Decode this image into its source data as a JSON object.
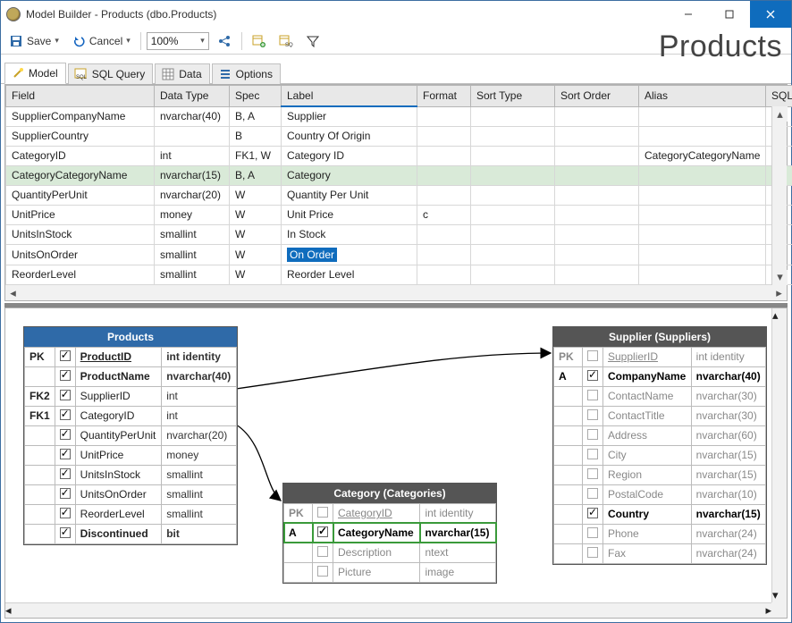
{
  "window": {
    "title": "Model Builder - Products (dbo.Products)"
  },
  "toolbar": {
    "save": "Save",
    "cancel": "Cancel",
    "zoom": "100%",
    "heading": "Products"
  },
  "tabs": {
    "model": "Model",
    "sql": "SQL Query",
    "data": "Data",
    "options": "Options"
  },
  "grid": {
    "headers": {
      "field": "Field",
      "dataType": "Data Type",
      "spec": "Spec",
      "label": "Label",
      "format": "Format",
      "sortType": "Sort Type",
      "sortOrder": "Sort Order",
      "alias": "Alias",
      "sqlfn": "SQL Fn"
    },
    "rows": [
      {
        "field": "SupplierCompanyName",
        "dataType": "nvarchar(40)",
        "spec": "B, A",
        "label": "Supplier",
        "format": "",
        "sortType": "",
        "sortOrder": "",
        "alias": ""
      },
      {
        "field": "SupplierCountry",
        "dataType": "",
        "spec": "B",
        "label": "Country Of Origin",
        "format": "",
        "sortType": "",
        "sortOrder": "",
        "alias": ""
      },
      {
        "field": "CategoryID",
        "dataType": "int",
        "spec": "FK1, W",
        "label": "Category ID",
        "format": "",
        "sortType": "",
        "sortOrder": "",
        "alias": "CategoryCategoryName"
      },
      {
        "field": "CategoryCategoryName",
        "dataType": "nvarchar(15)",
        "spec": "B, A",
        "label": "Category",
        "format": "",
        "sortType": "",
        "sortOrder": "",
        "alias": ""
      },
      {
        "field": "QuantityPerUnit",
        "dataType": "nvarchar(20)",
        "spec": "W",
        "label": "Quantity Per Unit",
        "format": "",
        "sortType": "",
        "sortOrder": "",
        "alias": ""
      },
      {
        "field": "UnitPrice",
        "dataType": "money",
        "spec": "W",
        "label": "Unit Price",
        "format": "c",
        "sortType": "",
        "sortOrder": "",
        "alias": ""
      },
      {
        "field": "UnitsInStock",
        "dataType": "smallint",
        "spec": "W",
        "label": "In Stock",
        "format": "",
        "sortType": "",
        "sortOrder": "",
        "alias": ""
      },
      {
        "field": "UnitsOnOrder",
        "dataType": "smallint",
        "spec": "W",
        "label": "On Order",
        "format": "",
        "sortType": "",
        "sortOrder": "",
        "alias": ""
      },
      {
        "field": "ReorderLevel",
        "dataType": "smallint",
        "spec": "W",
        "label": "Reorder Level",
        "format": "",
        "sortType": "",
        "sortOrder": "",
        "alias": ""
      }
    ]
  },
  "entities": {
    "products": {
      "title": "Products",
      "cols": [
        {
          "key": "PK",
          "chk": true,
          "name": "ProductID",
          "type": "int identity",
          "bold": true,
          "under": true
        },
        {
          "key": "",
          "chk": true,
          "name": "ProductName",
          "type": "nvarchar(40)",
          "bold": true
        },
        {
          "key": "FK2",
          "chk": true,
          "name": "SupplierID",
          "type": "int"
        },
        {
          "key": "FK1",
          "chk": true,
          "name": "CategoryID",
          "type": "int"
        },
        {
          "key": "",
          "chk": true,
          "name": "QuantityPerUnit",
          "type": "nvarchar(20)"
        },
        {
          "key": "",
          "chk": true,
          "name": "UnitPrice",
          "type": "money"
        },
        {
          "key": "",
          "chk": true,
          "name": "UnitsInStock",
          "type": "smallint"
        },
        {
          "key": "",
          "chk": true,
          "name": "UnitsOnOrder",
          "type": "smallint"
        },
        {
          "key": "",
          "chk": true,
          "name": "ReorderLevel",
          "type": "smallint"
        },
        {
          "key": "",
          "chk": true,
          "name": "Discontinued",
          "type": "bit",
          "bold": true
        }
      ]
    },
    "category": {
      "title": "Category (Categories)",
      "cols": [
        {
          "key": "PK",
          "chk": false,
          "name": "CategoryID",
          "type": "int identity",
          "under": true,
          "dim": true
        },
        {
          "key": "A",
          "chk": true,
          "name": "CategoryName",
          "type": "nvarchar(15)",
          "highlight": true
        },
        {
          "key": "",
          "chk": false,
          "name": "Description",
          "type": "ntext",
          "dim": true
        },
        {
          "key": "",
          "chk": false,
          "name": "Picture",
          "type": "image",
          "dim": true
        }
      ]
    },
    "supplier": {
      "title": "Supplier (Suppliers)",
      "cols": [
        {
          "key": "PK",
          "chk": false,
          "name": "SupplierID",
          "type": "int identity",
          "under": true,
          "dim": true
        },
        {
          "key": "A",
          "chk": true,
          "name": "CompanyName",
          "type": "nvarchar(40)",
          "bold": true
        },
        {
          "key": "",
          "chk": false,
          "name": "ContactName",
          "type": "nvarchar(30)",
          "dim": true
        },
        {
          "key": "",
          "chk": false,
          "name": "ContactTitle",
          "type": "nvarchar(30)",
          "dim": true
        },
        {
          "key": "",
          "chk": false,
          "name": "Address",
          "type": "nvarchar(60)",
          "dim": true
        },
        {
          "key": "",
          "chk": false,
          "name": "City",
          "type": "nvarchar(15)",
          "dim": true
        },
        {
          "key": "",
          "chk": false,
          "name": "Region",
          "type": "nvarchar(15)",
          "dim": true
        },
        {
          "key": "",
          "chk": false,
          "name": "PostalCode",
          "type": "nvarchar(10)",
          "dim": true
        },
        {
          "key": "",
          "chk": true,
          "name": "Country",
          "type": "nvarchar(15)",
          "bold": true
        },
        {
          "key": "",
          "chk": false,
          "name": "Phone",
          "type": "nvarchar(24)",
          "dim": true
        },
        {
          "key": "",
          "chk": false,
          "name": "Fax",
          "type": "nvarchar(24)",
          "dim": true
        }
      ]
    }
  }
}
